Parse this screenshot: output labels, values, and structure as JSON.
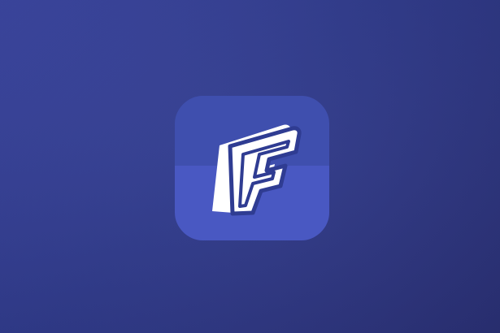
{
  "background": {
    "colors": [
      "#3d48a5",
      "#313c8e",
      "#2b3177"
    ]
  },
  "app_icon": {
    "icon": "f-logo-icon",
    "colors": {
      "top": "#3f4fae",
      "bottom": "#4958c2",
      "letter_fill": "#ffffff",
      "letter_outline": "#2f3c92"
    }
  }
}
